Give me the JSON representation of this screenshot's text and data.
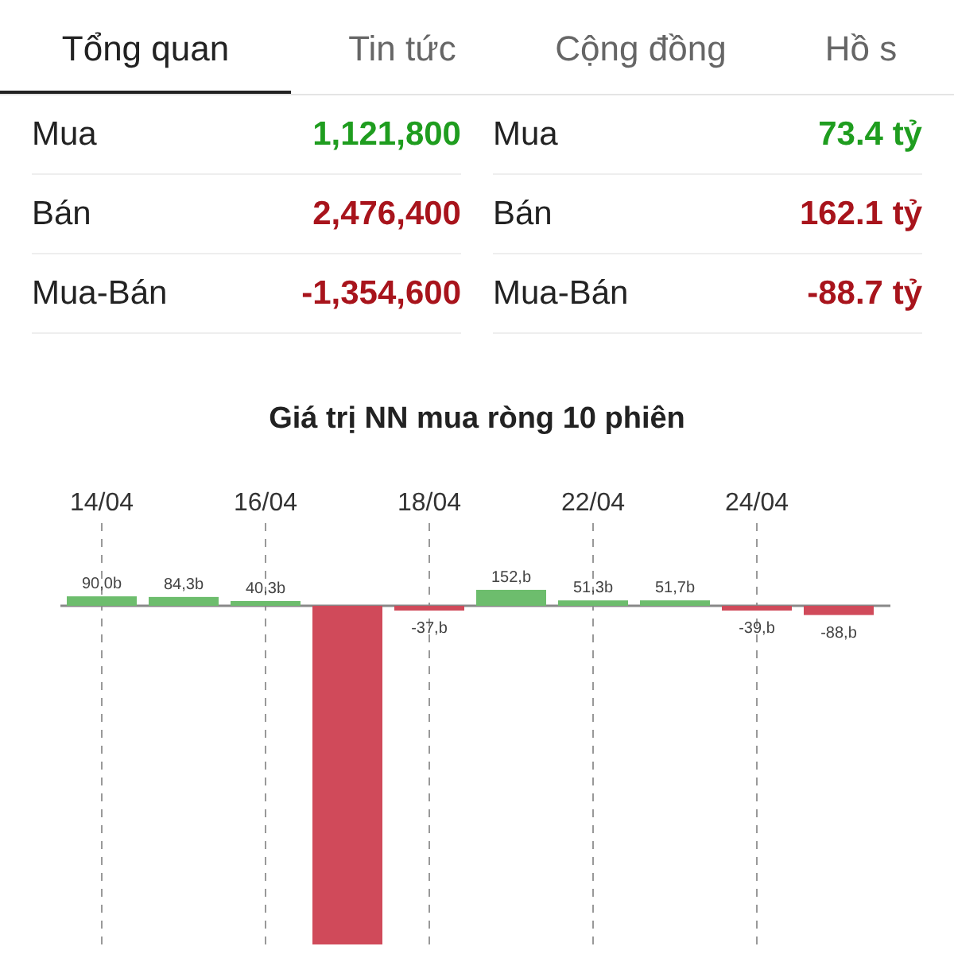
{
  "tabs": [
    {
      "label": "Tổng quan",
      "selected": true
    },
    {
      "label": "Tin tức",
      "selected": false
    },
    {
      "label": "Cộng đồng",
      "selected": false
    },
    {
      "label": "Hồ s",
      "selected": false
    }
  ],
  "summary": {
    "columns": [
      {
        "rows": [
          {
            "label": "Mua",
            "value": "1,121,800",
            "color": "#1f9d1f"
          },
          {
            "label": "Bán",
            "value": "2,476,400",
            "color": "#a8141c"
          },
          {
            "label": "Mua-Bán",
            "value": "-1,354,600",
            "color": "#a8141c"
          }
        ]
      },
      {
        "rows": [
          {
            "label": "Mua",
            "value": "73.4 tỷ",
            "color": "#1f9d1f"
          },
          {
            "label": "Bán",
            "value": "162.1 tỷ",
            "color": "#a8141c"
          },
          {
            "label": "Mua-Bán",
            "value": "-88.7 tỷ",
            "color": "#a8141c"
          }
        ]
      }
    ]
  },
  "chart": {
    "chart_data": {
      "type": "bar",
      "title": "Giá trị NN mua ròng 10 phiên",
      "grid": true,
      "categories": [
        "14/04",
        null,
        "16/04",
        null,
        "18/04",
        null,
        "22/04",
        null,
        "24/04",
        null
      ],
      "values": [
        90.0,
        84.3,
        40.3,
        -3230,
        -37,
        152,
        51.3,
        51.7,
        -39,
        -88
      ],
      "value_labels": [
        "90,0b",
        "84,3b",
        "40,3b",
        null,
        "-37,b",
        "152,b",
        "51,3b",
        "51,7b",
        "-39,b",
        "-88,b"
      ]
    }
  }
}
